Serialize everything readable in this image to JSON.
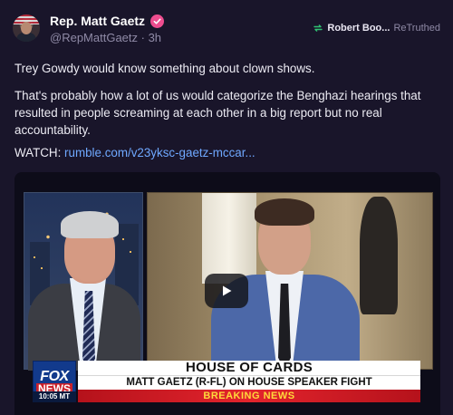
{
  "post": {
    "author": {
      "display_name": "Rep. Matt Gaetz",
      "handle": "@RepMattGaetz",
      "separator": " · ",
      "time_ago": "3h",
      "verified_color": "#ee4d8f"
    },
    "retruth": {
      "by": "Robert Boo...",
      "label": "ReTruthed",
      "icon": "retruth-icon",
      "icon_color": "#2fbf71"
    },
    "paragraphs": [
      "Trey Gowdy would know something about clown shows.",
      "That's probably how a lot of us would categorize the Benghazi hearings that resulted in people screaming at each other in a big report but no real accountability."
    ],
    "watch": {
      "prefix": "WATCH: ",
      "link_text": "rumble.com/v23yksc-gaetz-mccar..."
    },
    "video": {
      "play_icon": "play-icon",
      "chyron": {
        "network_top": "FOX",
        "network_bottom": "NEWS",
        "time": "10:05 MT",
        "headline": "HOUSE OF CARDS",
        "subheadline": "MATT GAETZ (R-FL) ON HOUSE SPEAKER FIGHT",
        "banner": "BREAKING NEWS"
      }
    }
  },
  "colors": {
    "background": "#19152a",
    "link": "#6fa8ff",
    "muted": "#8f8aa6"
  }
}
